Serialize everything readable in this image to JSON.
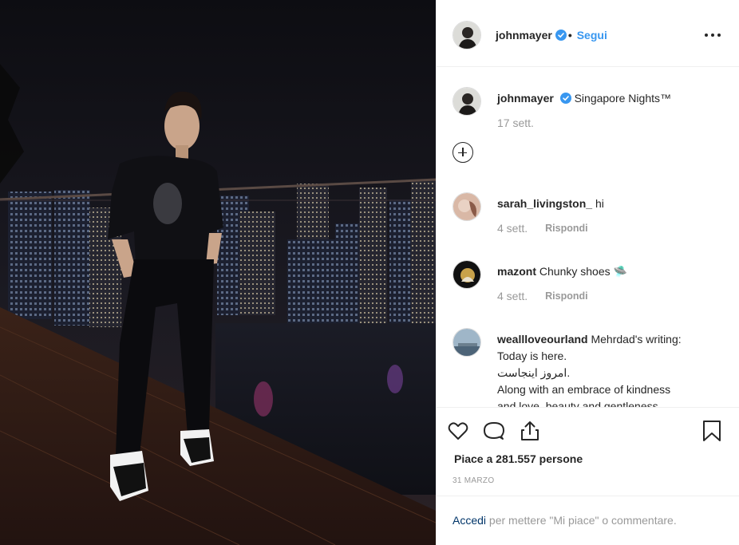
{
  "post": {
    "author": "johnmayer",
    "separator": "•",
    "follow_label": "Segui",
    "caption": "Singapore Nights™",
    "caption_time": "17 sett.",
    "likes_text": "Piace a 281.557 persone",
    "date": "31 MARZO",
    "reply_label": "Rispondi"
  },
  "comments": [
    {
      "user": "sarah_livingston_",
      "text": "hi",
      "time": "4 sett.",
      "reply": "Rispondi"
    },
    {
      "user": "mazont",
      "text": "Chunky shoes 🛸",
      "time": "4 sett.",
      "reply": "Rispondi"
    },
    {
      "user": "weallloveourland",
      "text": "Mehrdad's writing:",
      "lines": [
        "Today is here.",
        "امروز اینجاست.",
        "Along with an embrace of kindness",
        "and love, beauty and gentleness"
      ]
    }
  ],
  "footer": {
    "login_link": "Accedi",
    "login_text": "per mettere \"Mi piace\" o commentare."
  },
  "colors": {
    "link_blue": "#3897f0",
    "verified_blue": "#3897f0",
    "accedi_blue": "#003569",
    "muted_gray": "#999999",
    "text": "#262626"
  },
  "icons": [
    "verified-badge-icon",
    "more-options-icon",
    "add-comment-icon",
    "heart-icon",
    "comment-icon",
    "share-icon",
    "bookmark-icon"
  ]
}
